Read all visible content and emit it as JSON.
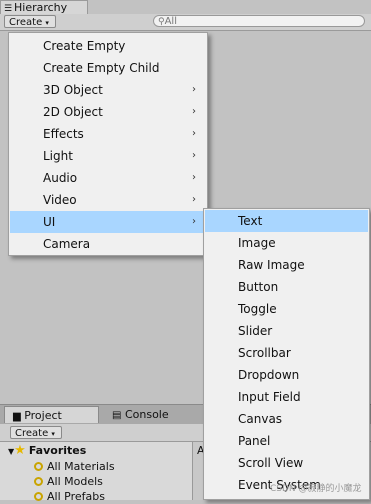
{
  "hierarchy": {
    "tab_label": "Hierarchy",
    "tab_icon": "list-icon",
    "create_label": "Create",
    "search_placeholder": "All"
  },
  "context_menu": {
    "items": [
      {
        "label": "Create Empty",
        "has_submenu": false
      },
      {
        "label": "Create Empty Child",
        "has_submenu": false
      },
      {
        "label": "3D Object",
        "has_submenu": true
      },
      {
        "label": "2D Object",
        "has_submenu": true
      },
      {
        "label": "Effects",
        "has_submenu": true
      },
      {
        "label": "Light",
        "has_submenu": true
      },
      {
        "label": "Audio",
        "has_submenu": true
      },
      {
        "label": "Video",
        "has_submenu": true
      },
      {
        "label": "UI",
        "has_submenu": true,
        "highlighted": true
      },
      {
        "label": "Camera",
        "has_submenu": false
      }
    ],
    "arrow_glyph": "›"
  },
  "ui_submenu": {
    "items": [
      {
        "label": "Text",
        "highlighted": true
      },
      {
        "label": "Image"
      },
      {
        "label": "Raw Image"
      },
      {
        "label": "Button"
      },
      {
        "label": "Toggle"
      },
      {
        "label": "Slider"
      },
      {
        "label": "Scrollbar"
      },
      {
        "label": "Dropdown"
      },
      {
        "label": "Input Field"
      },
      {
        "label": "Canvas"
      },
      {
        "label": "Panel"
      },
      {
        "label": "Scroll View"
      },
      {
        "label": "Event System"
      }
    ]
  },
  "project": {
    "tabs": [
      {
        "label": "Project",
        "icon": "folder-icon"
      },
      {
        "label": "Console",
        "icon": "console-icon"
      }
    ],
    "create_label": "Create",
    "favorites_label": "Favorites",
    "favorites": [
      "All Materials",
      "All Models",
      "All Prefabs"
    ],
    "breadcrumb": "As"
  },
  "watermark": "CSDN @寂静的小魔龙",
  "colors": {
    "highlight": "#a9d6ff",
    "menu_bg": "#f0f0f0",
    "panel_bg": "#c2c2c2",
    "favorites_star": "#e6b800"
  }
}
